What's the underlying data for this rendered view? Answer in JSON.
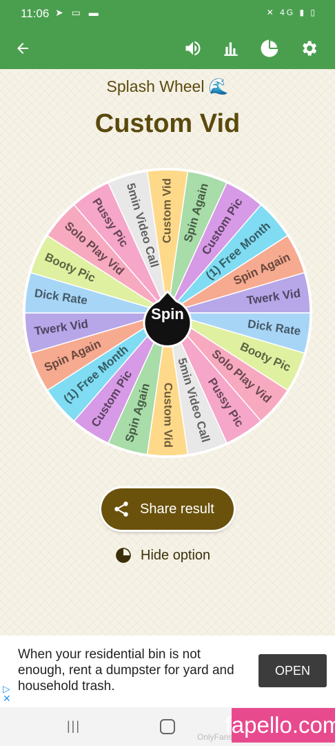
{
  "status_bar": {
    "time": "11:06",
    "network": "4G"
  },
  "app_bar": {
    "back_icon": "arrow-left-icon",
    "sound_icon": "volume-icon",
    "stats_icon": "bar-chart-icon",
    "hide_icon": "pie-icon",
    "settings_icon": "gear-icon"
  },
  "header": {
    "subtitle": "Splash Wheel 🌊",
    "title": "Custom Vid"
  },
  "wheel": {
    "center_label": "Spin",
    "segments": [
      {
        "label": "Custom Vid",
        "color": "#ffd98a"
      },
      {
        "label": "Spin Again",
        "color": "#a8dca8"
      },
      {
        "label": "Custom Pic",
        "color": "#d79ae6"
      },
      {
        "label": "(1) Free Month",
        "color": "#7fdcf2"
      },
      {
        "label": "Spin Again",
        "color": "#f6aa90"
      },
      {
        "label": "Twerk Vid",
        "color": "#b7a6e8"
      },
      {
        "label": "Dick Rate",
        "color": "#a7d5f6"
      },
      {
        "label": "Booty Pic",
        "color": "#dff0a0"
      },
      {
        "label": "Solo Play Vid",
        "color": "#f7a9bf"
      },
      {
        "label": "Pussy Pic",
        "color": "#f5a6c9"
      },
      {
        "label": "5min Video Call",
        "color": "#e8e8e8"
      },
      {
        "label": "Custom Vid",
        "color": "#ffd98a"
      },
      {
        "label": "Spin Again",
        "color": "#a8dca8"
      },
      {
        "label": "Custom Pic",
        "color": "#d79ae6"
      },
      {
        "label": "(1) Free Month",
        "color": "#7fdcf2"
      },
      {
        "label": "Spin Again",
        "color": "#f6aa90"
      },
      {
        "label": "Twerk Vid",
        "color": "#b7a6e8"
      },
      {
        "label": "Dick Rate",
        "color": "#a7d5f6"
      },
      {
        "label": "Booty Pic",
        "color": "#dff0a0"
      },
      {
        "label": "Solo Play Vid",
        "color": "#f7a9bf"
      },
      {
        "label": "Pussy Pic",
        "color": "#f5a6c9"
      },
      {
        "label": "5min Video Call",
        "color": "#e8e8e8"
      }
    ]
  },
  "actions": {
    "share_label": "Share result",
    "hide_label": "Hide option"
  },
  "ad": {
    "text": "When your residential bin is not enough, rent a dumpster for yard and household trash.",
    "button_label": "OPEN"
  },
  "nav": {
    "items": [
      "recent-apps-icon",
      "home-icon",
      "back-icon"
    ]
  },
  "watermark": {
    "text": "fapello.com",
    "ghost": "OnlyFans"
  },
  "colors": {
    "app_green": "#4a9f4f",
    "brand_brown": "#6a520c",
    "title_brown": "#5b4a0d"
  }
}
